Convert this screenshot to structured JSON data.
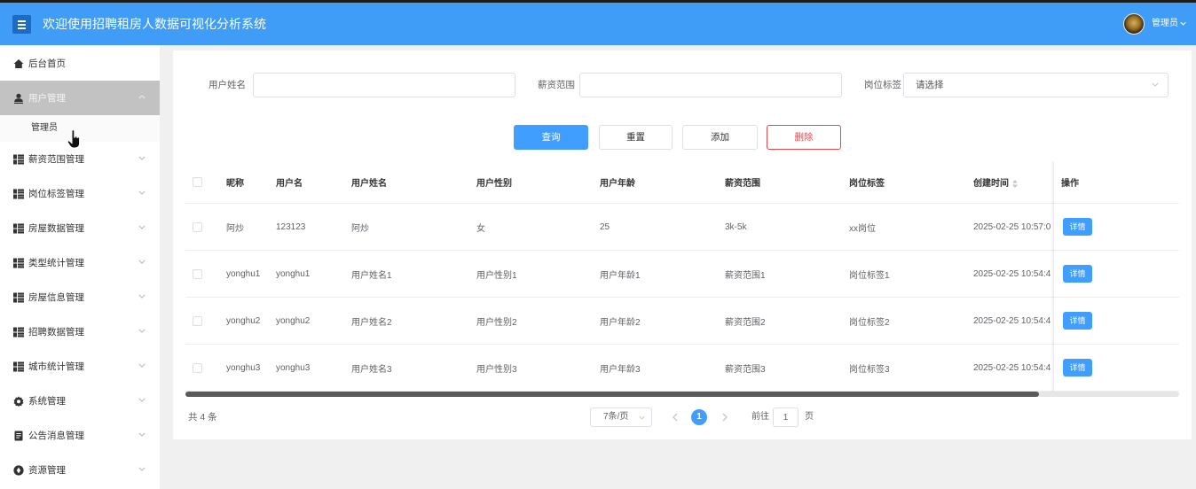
{
  "header": {
    "title": "欢迎使用招聘租房人数据可视化分析系统",
    "user_label": "管理员",
    "menu_icon": "hamburger-menu-icon",
    "dropdown_icon": "chevron-down-icon"
  },
  "sidebar": {
    "items": [
      {
        "label": "后台首页",
        "icon": "home-icon"
      },
      {
        "label": "用户管理",
        "icon": "user-icon",
        "active": true,
        "expanded": true,
        "children": [
          {
            "label": "管理员"
          }
        ]
      },
      {
        "label": "薪资范围管理",
        "icon": "grid-icon"
      },
      {
        "label": "岗位标签管理",
        "icon": "grid-icon"
      },
      {
        "label": "房屋数据管理",
        "icon": "grid-icon"
      },
      {
        "label": "类型统计管理",
        "icon": "grid-icon"
      },
      {
        "label": "房屋信息管理",
        "icon": "grid-icon"
      },
      {
        "label": "招聘数据管理",
        "icon": "grid-icon"
      },
      {
        "label": "城市统计管理",
        "icon": "grid-icon"
      },
      {
        "label": "系统管理",
        "icon": "gear-icon"
      },
      {
        "label": "公告消息管理",
        "icon": "document-icon"
      },
      {
        "label": "资源管理",
        "icon": "compass-icon"
      }
    ]
  },
  "search": {
    "fields": [
      {
        "label": "用户姓名",
        "value": ""
      },
      {
        "label": "薪资范围",
        "value": ""
      },
      {
        "label": "岗位标签",
        "placeholder": "请选择"
      }
    ],
    "buttons": {
      "query": "查询",
      "reset": "重置",
      "add": "添加",
      "delete": "删除"
    }
  },
  "table": {
    "columns": [
      "昵称",
      "用户名",
      "用户姓名",
      "用户性别",
      "用户年龄",
      "薪资范围",
      "岗位标签",
      "创建时间",
      "操作"
    ],
    "sort_icon": "sort-caret-icon",
    "rows": [
      {
        "nickname": "阿炒",
        "username": "123123",
        "name": "阿炒",
        "gender": "女",
        "age": "25",
        "salary_range": "3k-5k",
        "job_tag": "xx岗位",
        "created_time": "2025-02-25 10:57:0",
        "action": "详情"
      },
      {
        "nickname": "yonghu1",
        "username": "yonghu1",
        "name": "用户姓名1",
        "gender": "用户性别1",
        "age": "用户年龄1",
        "salary_range": "薪资范围1",
        "job_tag": "岗位标签1",
        "created_time": "2025-02-25 10:54:4",
        "action": "详情"
      },
      {
        "nickname": "yonghu2",
        "username": "yonghu2",
        "name": "用户姓名2",
        "gender": "用户性别2",
        "age": "用户年龄2",
        "salary_range": "薪资范围2",
        "job_tag": "岗位标签2",
        "created_time": "2025-02-25 10:54:4",
        "action": "详情"
      },
      {
        "nickname": "yonghu3",
        "username": "yonghu3",
        "name": "用户姓名3",
        "gender": "用户性别3",
        "age": "用户年龄3",
        "salary_range": "薪资范围3",
        "job_tag": "岗位标签3",
        "created_time": "2025-02-25 10:54:4",
        "action": "详情"
      }
    ]
  },
  "pagination": {
    "total_text": "共 4 条",
    "page_size": "7条/页",
    "current_page": "1",
    "goto_label": "前往",
    "goto_value": "1",
    "page_suffix": "页"
  },
  "colors": {
    "header": "#3f9cf7",
    "primary": "#409eff",
    "danger": "#e5484d",
    "sidebar_active": "#c2c2c2",
    "page_background": "#f0f0f0"
  }
}
